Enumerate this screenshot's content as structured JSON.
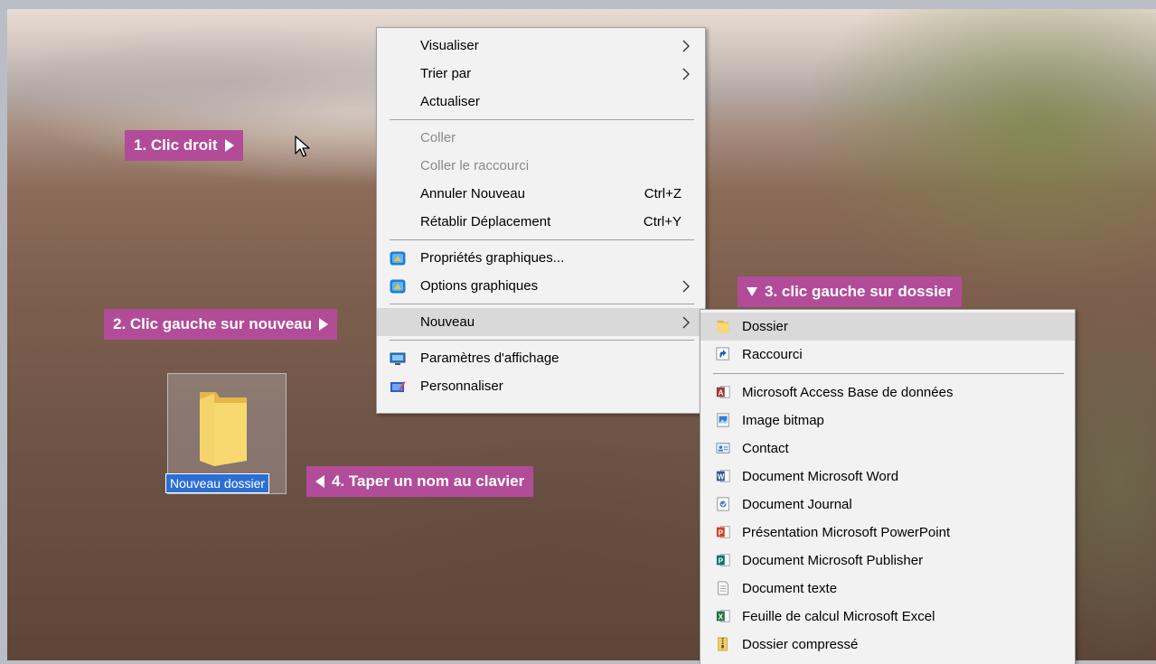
{
  "callouts": {
    "step1": "1. Clic droit",
    "step2": "2. Clic gauche sur nouveau",
    "step3": "3. clic gauche sur dossier",
    "step4": "4. Taper un nom au clavier"
  },
  "context_menu": {
    "items": [
      {
        "label": "Visualiser",
        "has_submenu": true
      },
      {
        "label": "Trier par",
        "has_submenu": true
      },
      {
        "label": "Actualiser"
      },
      {
        "label": "Coller",
        "disabled": true
      },
      {
        "label": "Coller le raccourci",
        "disabled": true
      },
      {
        "label": "Annuler Nouveau",
        "shortcut": "Ctrl+Z"
      },
      {
        "label": "Rétablir Déplacement",
        "shortcut": "Ctrl+Y"
      },
      {
        "label": "Propriétés graphiques...",
        "icon": "intel-graphics-icon"
      },
      {
        "label": "Options graphiques",
        "icon": "intel-graphics-icon",
        "has_submenu": true
      },
      {
        "label": "Nouveau",
        "has_submenu": true,
        "highlighted": true
      },
      {
        "label": "Paramètres d'affichage",
        "icon": "display-settings-icon"
      },
      {
        "label": "Personnaliser",
        "icon": "personalize-icon"
      }
    ]
  },
  "new_submenu": {
    "items": [
      {
        "label": "Dossier",
        "icon": "folder-icon",
        "highlighted": true
      },
      {
        "label": "Raccourci",
        "icon": "shortcut-icon"
      },
      {
        "label": "Microsoft Access Base de données",
        "icon": "access-icon"
      },
      {
        "label": "Image bitmap",
        "icon": "bitmap-icon"
      },
      {
        "label": "Contact",
        "icon": "contact-icon"
      },
      {
        "label": "Document Microsoft Word",
        "icon": "word-icon"
      },
      {
        "label": "Document Journal",
        "icon": "journal-icon"
      },
      {
        "label": "Présentation Microsoft PowerPoint",
        "icon": "powerpoint-icon"
      },
      {
        "label": "Document Microsoft Publisher",
        "icon": "publisher-icon"
      },
      {
        "label": "Document texte",
        "icon": "text-document-icon"
      },
      {
        "label": "Feuille de calcul Microsoft Excel",
        "icon": "excel-icon"
      },
      {
        "label": "Dossier compressé",
        "icon": "zip-folder-icon"
      }
    ]
  },
  "desktop_folder": {
    "name": "Nouveau dossier",
    "icon": "folder-icon"
  },
  "colors": {
    "callout": "#b24c98",
    "selection": "#2c6fd3",
    "menu_bg": "#f2f2f2"
  }
}
